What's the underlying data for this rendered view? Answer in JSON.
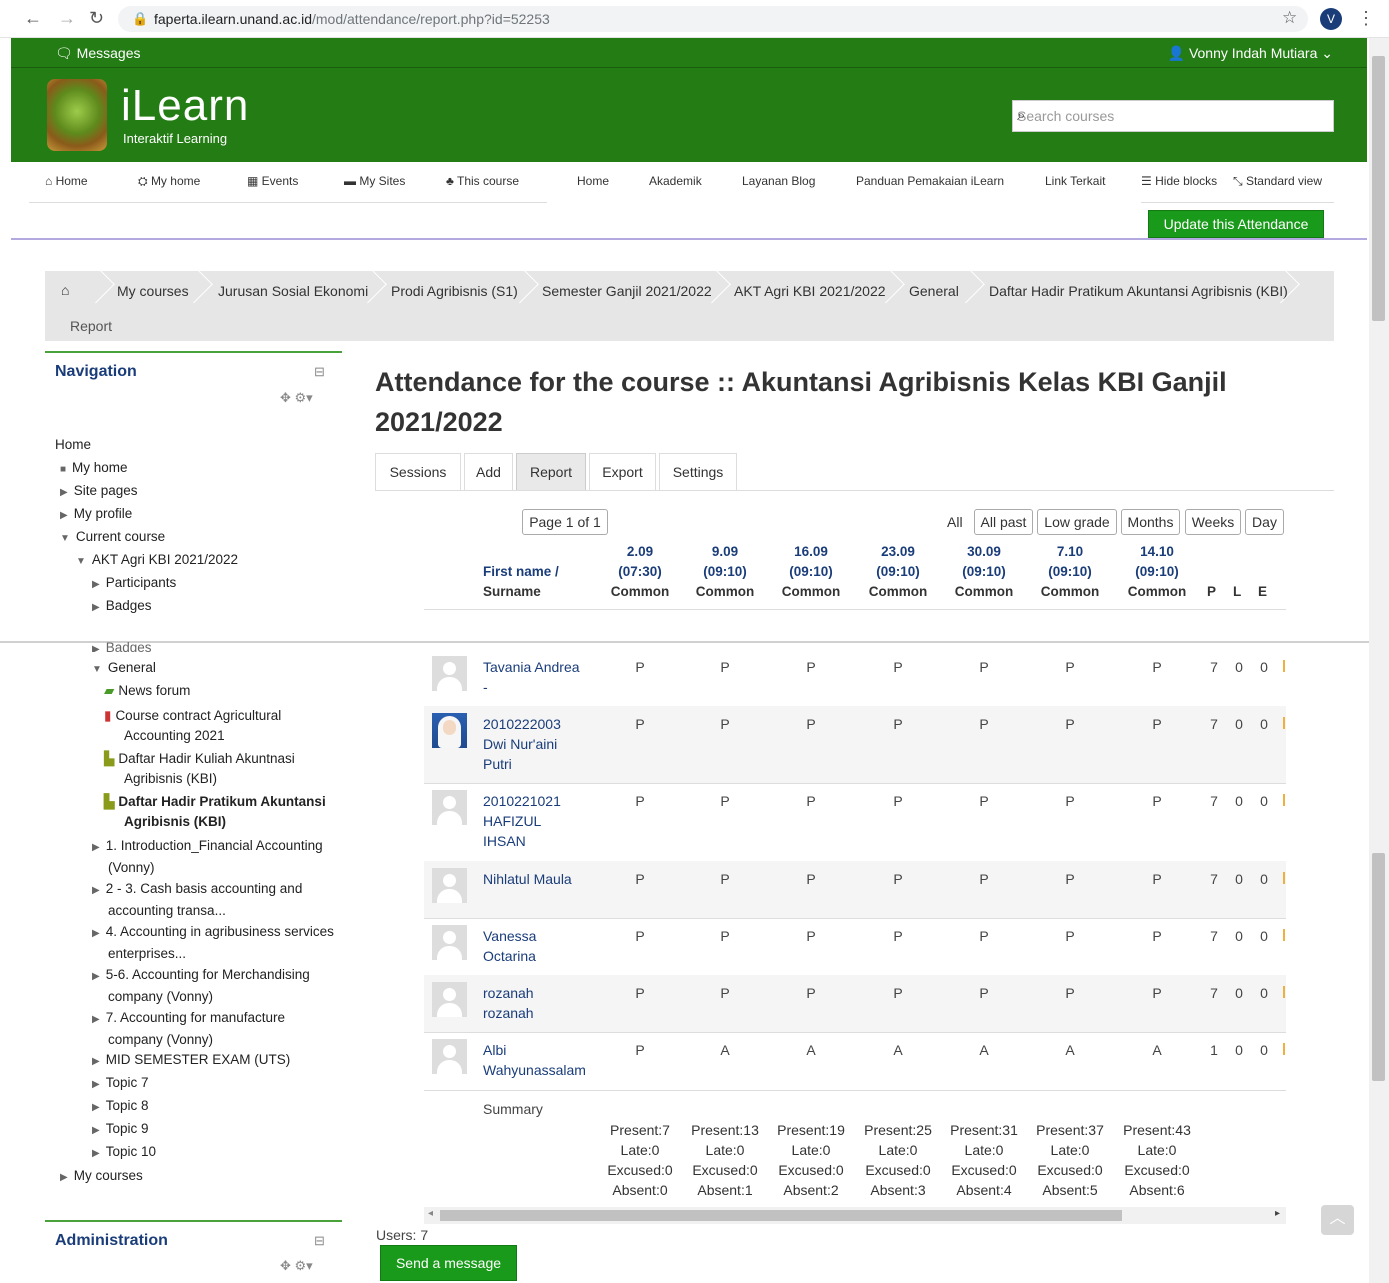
{
  "browser": {
    "url_host": "faperta.ilearn.unand.ac.id",
    "url_path": "/mod/attendance/report.php?id=52253",
    "profile_letter": "V"
  },
  "topbar": {
    "messages_label": "Messages",
    "user_name": "Vonny Indah Mutiara"
  },
  "header": {
    "logo_text": "iLearn",
    "logo_sub": "Interaktif Learning",
    "search_placeholder": "Search courses"
  },
  "navbar": {
    "items": [
      "Home",
      "My home",
      "Events",
      "My Sites",
      "This course",
      "Home",
      "Akademik",
      "Layanan Blog",
      "Panduan Pemakaian iLearn",
      "Link Terkait",
      "Hide blocks",
      "Standard view"
    ]
  },
  "update_button": "Update this Attendance",
  "breadcrumb": {
    "items": [
      "My courses",
      "Jurusan Sosial Ekonomi",
      "Prodi Agribisnis (S1)",
      "Semester Ganjil 2021/2022",
      "AKT Agri KBI 2021/2022",
      "General",
      "Daftar Hadir Pratikum Akuntansi Agribisnis (KBI)"
    ],
    "last": "Report"
  },
  "navigation": {
    "title": "Navigation",
    "home": "Home",
    "top_items": [
      "My home",
      "Site pages",
      "My profile",
      "Current course",
      "AKT Agri KBI 2021/2022",
      "Participants",
      "Badges"
    ],
    "badges_cut": "Badges",
    "general": "General",
    "news_forum": "News forum",
    "course_contract": [
      "Course contract Agricultural",
      "Accounting 2021"
    ],
    "daftar_kuliah": [
      "Daftar Hadir Kuliah Akuntnasi",
      "Agribisnis (KBI)"
    ],
    "daftar_pratikum": [
      "Daftar Hadir Pratikum Akuntansi",
      "Agribisnis (KBI)"
    ],
    "topics": [
      [
        "1. Introduction_Financial Accounting",
        "(Vonny)"
      ],
      [
        "2 - 3. Cash basis accounting and",
        "accounting transa..."
      ],
      [
        "4. Accounting in agribusiness services",
        "enterprises..."
      ],
      [
        "5-6. Accounting for Merchandising",
        "company (Vonny)"
      ],
      [
        "7. Accounting for manufacture",
        "company (Vonny)"
      ]
    ],
    "more": [
      "MID SEMESTER EXAM (UTS)",
      "Topic 7",
      "Topic 8",
      "Topic 9",
      "Topic 10"
    ],
    "my_courses": "My courses"
  },
  "administration": {
    "title": "Administration"
  },
  "page": {
    "title_line1": "Attendance for the course :: Akuntansi Agribisnis Kelas KBI Ganjil",
    "title_line2": "2021/2022"
  },
  "tabs": [
    "Sessions",
    "Add",
    "Report",
    "Export",
    "Settings"
  ],
  "paging": {
    "page_label": "Page 1 of 1",
    "all": "All",
    "filters": [
      "All past",
      "Low grade",
      "Months",
      "Weeks",
      "Day"
    ]
  },
  "table": {
    "name_header": [
      "First name /",
      "Surname"
    ],
    "sessions": [
      {
        "date": "2.09",
        "time": "(07:30)",
        "type": "Common"
      },
      {
        "date": "9.09",
        "time": "(09:10)",
        "type": "Common"
      },
      {
        "date": "16.09",
        "time": "(09:10)",
        "type": "Common"
      },
      {
        "date": "23.09",
        "time": "(09:10)",
        "type": "Common"
      },
      {
        "date": "30.09",
        "time": "(09:10)",
        "type": "Common"
      },
      {
        "date": "7.10",
        "time": "(09:10)",
        "type": "Common"
      },
      {
        "date": "14.10",
        "time": "(09:10)",
        "type": "Common"
      }
    ],
    "stat_headers": [
      "P",
      "L",
      "E"
    ],
    "rows": [
      {
        "name": [
          "Tavania Andrea",
          "-"
        ],
        "marks": [
          "P",
          "P",
          "P",
          "P",
          "P",
          "P",
          "P"
        ],
        "stats": [
          "7",
          "0",
          "0"
        ]
      },
      {
        "name": [
          "2010222003",
          "Dwi Nur'aini",
          "Putri"
        ],
        "marks": [
          "P",
          "P",
          "P",
          "P",
          "P",
          "P",
          "P"
        ],
        "stats": [
          "7",
          "0",
          "0"
        ]
      },
      {
        "name": [
          "2010221021",
          "HAFIZUL",
          "IHSAN"
        ],
        "marks": [
          "P",
          "P",
          "P",
          "P",
          "P",
          "P",
          "P"
        ],
        "stats": [
          "7",
          "0",
          "0"
        ]
      },
      {
        "name": [
          "Nihlatul Maula"
        ],
        "marks": [
          "P",
          "P",
          "P",
          "P",
          "P",
          "P",
          "P"
        ],
        "stats": [
          "7",
          "0",
          "0"
        ]
      },
      {
        "name": [
          "Vanessa",
          "Octarina"
        ],
        "marks": [
          "P",
          "P",
          "P",
          "P",
          "P",
          "P",
          "P"
        ],
        "stats": [
          "7",
          "0",
          "0"
        ]
      },
      {
        "name": [
          "rozanah",
          "rozanah"
        ],
        "marks": [
          "P",
          "P",
          "P",
          "P",
          "P",
          "P",
          "P"
        ],
        "stats": [
          "7",
          "0",
          "0"
        ]
      },
      {
        "name": [
          "Albi",
          "Wahyunassalam"
        ],
        "marks": [
          "P",
          "A",
          "A",
          "A",
          "A",
          "A",
          "A"
        ],
        "stats": [
          "1",
          "0",
          "0"
        ]
      }
    ],
    "summary_label": "Summary",
    "summary": [
      [
        "Present:7",
        "Late:0",
        "Excused:0",
        "Absent:0"
      ],
      [
        "Present:13",
        "Late:0",
        "Excused:0",
        "Absent:1"
      ],
      [
        "Present:19",
        "Late:0",
        "Excused:0",
        "Absent:2"
      ],
      [
        "Present:25",
        "Late:0",
        "Excused:0",
        "Absent:3"
      ],
      [
        "Present:31",
        "Late:0",
        "Excused:0",
        "Absent:4"
      ],
      [
        "Present:37",
        "Late:0",
        "Excused:0",
        "Absent:5"
      ],
      [
        "Present:43",
        "Late:0",
        "Excused:0",
        "Absent:6"
      ]
    ]
  },
  "users_count": "Users: 7",
  "send_message": "Send a message"
}
